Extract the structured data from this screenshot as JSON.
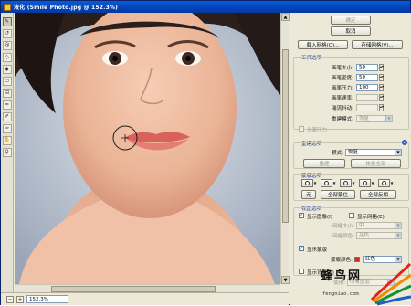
{
  "window": {
    "title": "液化 (Smile Photo.jpg @ 152.3%)"
  },
  "toolbar": {
    "tools": [
      "forward-warp",
      "reconstruct",
      "twirl",
      "pucker",
      "bloat",
      "push-left",
      "mirror",
      "turbulence",
      "freeze-mask",
      "thaw-mask",
      "hand",
      "zoom"
    ]
  },
  "status": {
    "zoom": "152.3%"
  },
  "panel": {
    "ok_label": "确定",
    "cancel_label": "取消",
    "load_mesh_label": "载入网格(O)...",
    "save_mesh_label": "存储网格(V)...",
    "tool_options_header": "工具选项",
    "brush_size_label": "画笔大小:",
    "brush_size_value": "50",
    "brush_density_label": "画笔密度:",
    "brush_density_value": "50",
    "brush_pressure_label": "画笔压力:",
    "brush_pressure_value": "100",
    "brush_rate_label": "画笔速率:",
    "brush_rate_value": "",
    "turbulent_jitter_label": "湍流抖动:",
    "turbulent_jitter_value": "",
    "reconstruct_mode_label": "重建模式:",
    "reconstruct_mode_value": "恢复",
    "stylus_pressure_label": "光笔压力",
    "reconstruct_options_header": "重建选项",
    "mode_label": "模式:",
    "mode_value": "恢复",
    "reconstruct_button": "重建",
    "restore_all_button": "恢复全部",
    "mask_options_header": "蒙版选项",
    "none_button": "无",
    "mask_all_button": "全部蒙住",
    "invert_all_button": "全部反相",
    "view_options_header": "视图选项",
    "show_image_label": "显示图像(I)",
    "show_mesh_label": "显示网格(E)",
    "mesh_size_label": "网格大小:",
    "mesh_size_value": "中",
    "mesh_color_label": "网格颜色:",
    "mesh_color_value": "灰色",
    "show_mask_label": "显示蒙版",
    "mask_color_label": "蒙版颜色:",
    "mask_color_value": "红色",
    "mask_color_hex": "#e0201a",
    "show_backdrop_label": "显示背景(K)",
    "use_label": "使用:",
    "use_value": "所有图层"
  },
  "watermark": {
    "brand": "蜂鸟网",
    "url": "fengniao.com"
  },
  "colors": {
    "title_bar": "#0a5ad8",
    "panel_bg": "#ece9d8",
    "section_header": "#1c3f95"
  }
}
